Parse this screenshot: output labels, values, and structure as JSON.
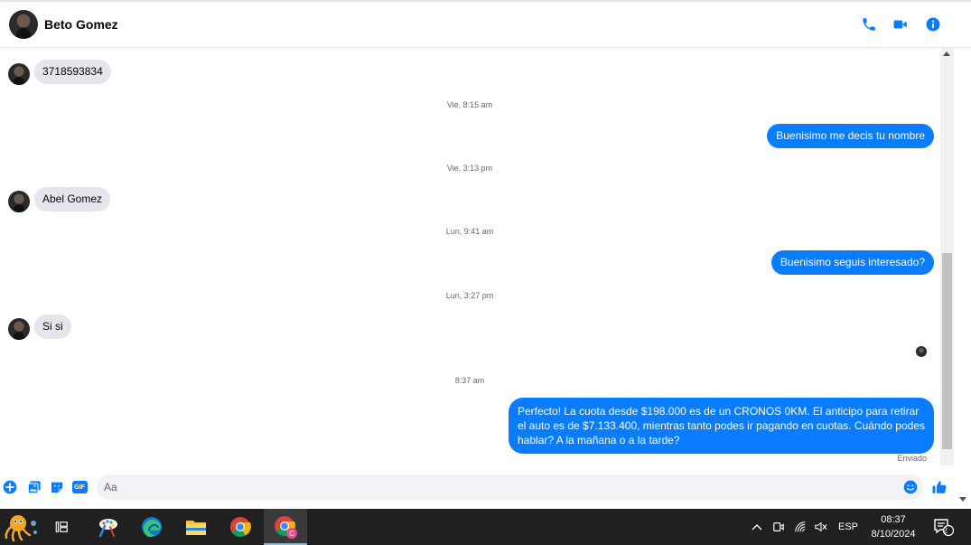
{
  "header": {
    "contact_name": "Beto Gomez",
    "icons": [
      "phone-icon",
      "video-call-icon",
      "info-icon"
    ]
  },
  "messages": [
    {
      "type": "in",
      "text": "3718593834"
    },
    {
      "type": "timestamp",
      "text": "Vie, 8:15 am"
    },
    {
      "type": "out",
      "text": "Buenisimo me decis tu nombre"
    },
    {
      "type": "timestamp",
      "text": "Vie, 3:13 pm"
    },
    {
      "type": "in",
      "text": "Abel Gomez"
    },
    {
      "type": "timestamp",
      "text": "Lun, 9:41 am"
    },
    {
      "type": "out",
      "text": "Buenisimo seguis interesado?"
    },
    {
      "type": "timestamp",
      "text": "Lun, 3:27 pm"
    },
    {
      "type": "in",
      "text": "Si si"
    },
    {
      "type": "timestamp",
      "text": "8:37 am"
    },
    {
      "type": "out",
      "text": "Perfecto! La cuota desde $198.000 es de un CRONOS 0KM. El anticipo para retirar el auto es de $7.133.400, mientras tanto podes ir pagando en cuotas. Cuándo podes hablar? A la mañana o a la tarde?"
    }
  ],
  "sent_status": "Enviado",
  "composer": {
    "placeholder": "Aa",
    "gif_label": "GIF",
    "icons": [
      "plus-icon",
      "image-icon",
      "sticker-icon",
      "gif-icon",
      "emoji-icon",
      "thumbs-up-icon"
    ]
  },
  "taskbar": {
    "apps": [
      "octopus-app-icon",
      "task-view-icon",
      "paint-app-icon",
      "edge-icon",
      "file-explorer-icon",
      "chrome-icon",
      "chrome-profile-icon"
    ],
    "language": "ESP",
    "time": "08:37",
    "date": "8/10/2024",
    "notification_count": "2"
  },
  "colors": {
    "accent": "#0a7cff",
    "incoming_bubble": "#e4e6eb",
    "taskbar": "#202020"
  }
}
